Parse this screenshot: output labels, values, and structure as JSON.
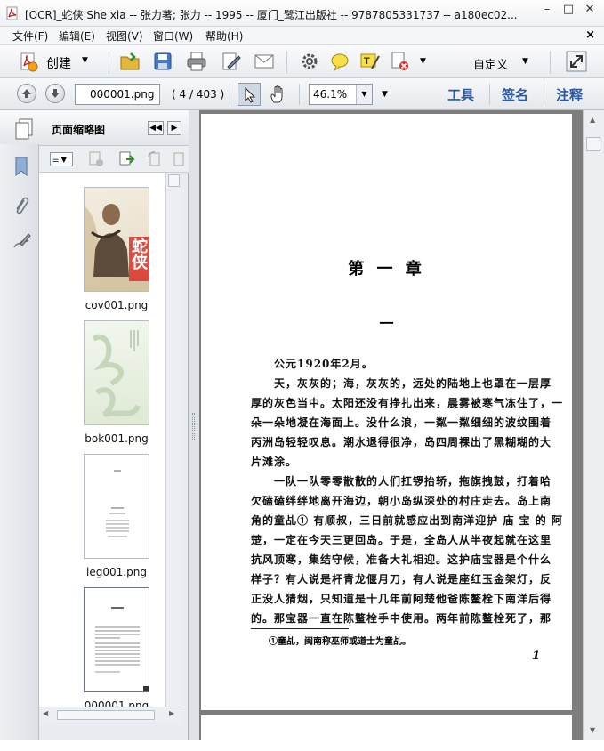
{
  "window": {
    "title": "[OCR]_蛇侠 She xia -- 张力著; 张力 -- 1995 -- 厦门_鹭江出版社 -- 9787805331737 -- a180ec02..."
  },
  "menu": {
    "items": [
      "文件(F)",
      "编辑(E)",
      "视图(V)",
      "窗口(W)",
      "帮助(H)"
    ],
    "close_glyph": "×"
  },
  "toolbar": {
    "create_label": "创建",
    "custom_label": "自定义"
  },
  "nav": {
    "page_field_value": "000001.png",
    "page_count": "( 4 / 403 )",
    "zoom_value": "46.1%",
    "tools_label": "工具",
    "sign_label": "签名",
    "comment_label": "注释"
  },
  "panel": {
    "title": "页面缩略图",
    "thumbnails": [
      {
        "label": "cov001.png",
        "cover_chars": "蛇侠"
      },
      {
        "label": "bok001.png"
      },
      {
        "label": "leg001.png"
      },
      {
        "label": "000001.png"
      }
    ]
  },
  "document": {
    "chapter_title": "第 一 章",
    "section_mark": "一",
    "paragraphs": [
      "公元1920年2月。",
      "天，灰灰的；海，灰灰的，远处的陆地上也罩在一层厚",
      "厚的灰色当中。太阳还没有挣扎出来，晨雾被寒气冻住了，一",
      "朵一朵地凝在海面上。没什么浪，一粼一粼细细的波纹围着",
      "丙洲岛轻轻叹息。潮水退得很净，岛四周裸出了黑糊糊的大",
      "片滩涂。",
      "一队一队零零散散的人们扛锣抬轿，拖旗拽鼓，打着哈",
      "欠磕磕绊绊地离开海边，朝小岛纵深处的村庄走去。岛上南",
      "角的童乩① 有顺叔，三日前就感应出到南洋迎护 庙 宝 的 阿",
      "楚，一定在今天三更回岛。于是，全岛人从半夜起就在这里",
      "抗风顶寒，集结守候，准备大礼相迎。这护庙宝器是个什么",
      "样子？有人说是杆青龙偃月刀，有人说是座红玉金架灯，反",
      "正没人猜烟，只知道是十几年前阿楚他爸陈鳌栓下南洋后得",
      "的。那宝器一直在陈鳌栓手中使用。两年前陈鳌栓死了，那"
    ],
    "footnote": "①童乩，闽南称巫师或道士为童乩。",
    "page_number": "1"
  }
}
